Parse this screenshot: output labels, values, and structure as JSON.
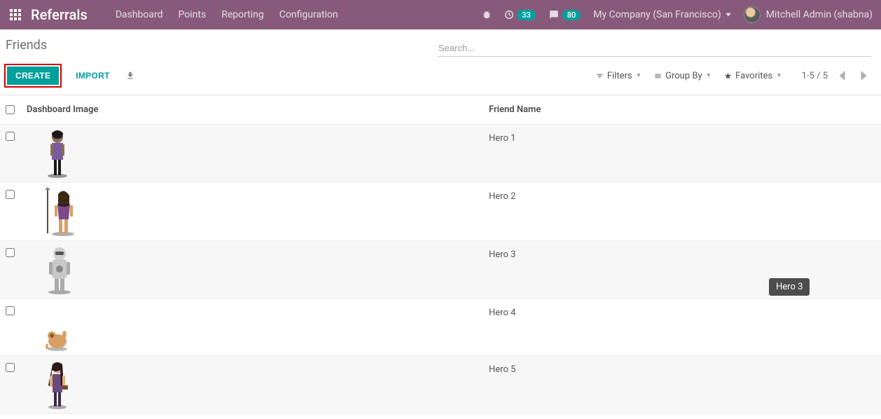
{
  "navbar": {
    "brand": "Referrals",
    "links": {
      "dashboard": "Dashboard",
      "points": "Points",
      "reporting": "Reporting",
      "configuration": "Configuration"
    },
    "debug_badge": "33",
    "messages_badge": "80",
    "company": "My Company (San Francisco)",
    "user": "Mitchell Admin (shabna)"
  },
  "breadcrumb": "Friends",
  "search": {
    "placeholder": "Search..."
  },
  "buttons": {
    "create": "CREATE",
    "import": "IMPORT"
  },
  "filters": {
    "filters": "Filters",
    "group_by": "Group By",
    "favorites": "Favorites"
  },
  "pager": {
    "text": "1-5 / 5"
  },
  "columns": {
    "dashboard_image": "Dashboard Image",
    "friend_name": "Friend Name"
  },
  "rows": [
    {
      "name": "Hero 1"
    },
    {
      "name": "Hero 2"
    },
    {
      "name": "Hero 3"
    },
    {
      "name": "Hero 4"
    },
    {
      "name": "Hero 5"
    }
  ],
  "tooltip": "Hero 3"
}
